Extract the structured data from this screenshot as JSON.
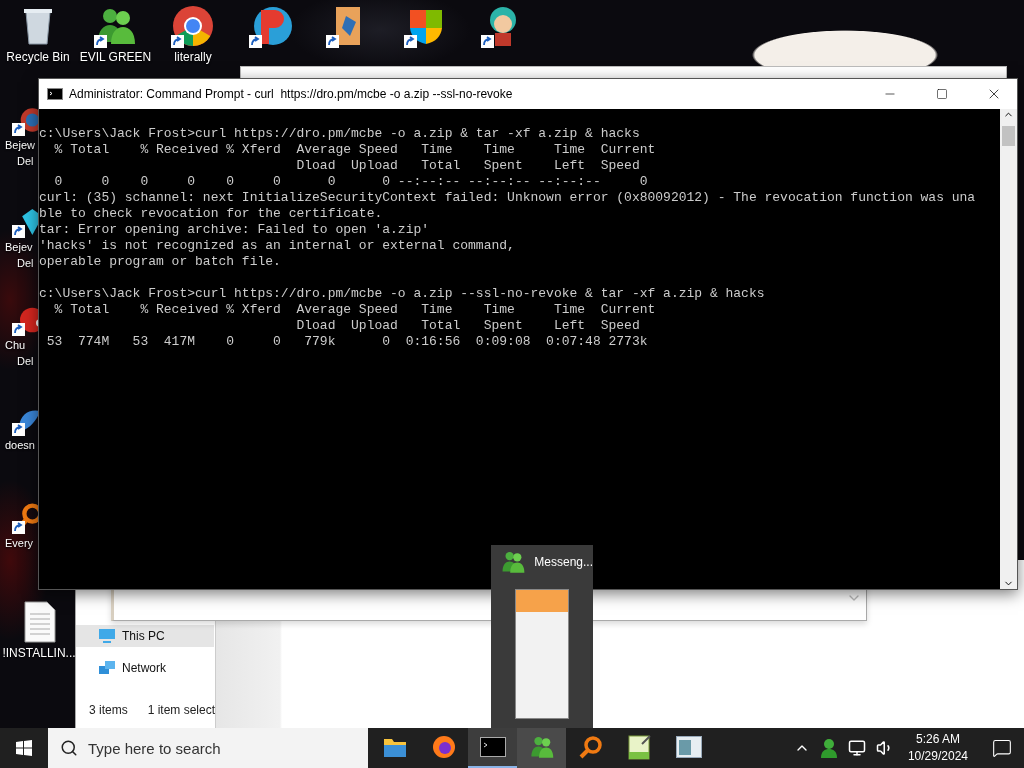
{
  "desktop_icons": [
    {
      "kind": "recycle",
      "shortcut": false,
      "label": [
        "Recycle Bin"
      ]
    },
    {
      "kind": "people",
      "shortcut": true,
      "label": [
        "EVIL GREEN"
      ]
    },
    {
      "kind": "chrome",
      "shortcut": true,
      "label": [
        "literally"
      ]
    },
    {
      "kind": "game",
      "shortcut": true
    },
    {
      "kind": "folder",
      "shortcut": true
    },
    {
      "kind": "shield",
      "shortcut": true
    },
    {
      "kind": "character",
      "shortcut": true
    }
  ],
  "side_icons": [
    {
      "kind": "swirl",
      "shortcut": true,
      "label": [
        "Bejew",
        "Del"
      ]
    },
    {
      "kind": "gem",
      "shortcut": true,
      "label": [
        "Bejev",
        "Del"
      ]
    },
    {
      "kind": "blob",
      "shortcut": true,
      "label": [
        "Chu",
        "Del"
      ]
    },
    {
      "kind": "bird",
      "shortcut": true,
      "label": [
        "doesn"
      ]
    },
    {
      "kind": "search",
      "shortcut": true,
      "label": [
        "Every"
      ]
    },
    {
      "kind": "document",
      "shortcut": false,
      "label": [
        "!INSTALLIN..."
      ]
    }
  ],
  "console": {
    "title": "Administrator: Command Prompt - curl  https://dro.pm/mcbe -o a.zip --ssl-no-revoke",
    "blocks": [
      [
        "c:\\Users\\Jack Frost>curl https://dro.pm/mcbe -o a.zip & tar -xf a.zip & hacks",
        "  % Total    % Received % Xferd  Average Speed   Time    Time     Time  Current",
        "                                 Dload  Upload   Total   Spent    Left  Speed",
        "  0     0    0     0    0     0      0      0 --:--:-- --:--:-- --:--:--     0",
        "curl: (35) schannel: next InitializeSecurityContext failed: Unknown error (0x80092012) - The revocation function was una",
        "ble to check revocation for the certificate.",
        "tar: Error opening archive: Failed to open 'a.zip'",
        "'hacks' is not recognized as an internal or external command,",
        "operable program or batch file."
      ],
      [
        "c:\\Users\\Jack Frost>curl https://dro.pm/mcbe -o a.zip --ssl-no-revoke & tar -xf a.zip & hacks",
        "  % Total    % Received % Xferd  Average Speed   Time    Time     Time  Current",
        "                                 Dload  Upload   Total   Spent    Left  Speed",
        " 53  774M   53  417M    0     0   779k      0  0:16:56  0:09:08  0:07:48 2773k"
      ]
    ]
  },
  "explorer": {
    "nav": [
      {
        "label": "This PC",
        "kind": "pc",
        "selected": true
      },
      {
        "label": "Network",
        "kind": "network",
        "selected": false
      }
    ],
    "status": [
      "3 items",
      "1 item select"
    ]
  },
  "preview": {
    "title": "Messeng..."
  },
  "taskbar": {
    "search_placeholder": "Type here to search",
    "apps": [
      {
        "kind": "folder",
        "selected": false,
        "hovered": false
      },
      {
        "kind": "firefox",
        "selected": false,
        "hovered": false
      },
      {
        "kind": "console",
        "selected": true,
        "hovered": false
      },
      {
        "kind": "people",
        "selected": false,
        "hovered": true
      },
      {
        "kind": "search",
        "selected": false,
        "hovered": false
      },
      {
        "kind": "notepad",
        "selected": false,
        "hovered": false
      },
      {
        "kind": "window",
        "selected": false,
        "hovered": false
      }
    ],
    "clock": {
      "time": "5:26 AM",
      "date": "10/29/2024"
    }
  }
}
